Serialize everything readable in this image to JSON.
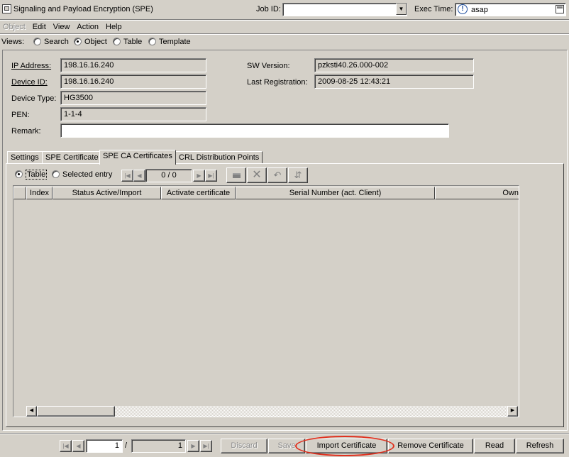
{
  "window": {
    "title": "Signaling and Payload Encryption (SPE)"
  },
  "job": {
    "label": "Job ID:",
    "value": ""
  },
  "exec": {
    "label": "Exec Time:",
    "value": "asap"
  },
  "menu": {
    "object": "Object",
    "edit": "Edit",
    "view": "View",
    "action": "Action",
    "help": "Help"
  },
  "views": {
    "label": "Views:",
    "options": [
      "Search",
      "Object",
      "Table",
      "Template"
    ],
    "selected": "Object"
  },
  "fields": {
    "ip_label": "IP Address:",
    "ip_value": "198.16.16.240",
    "device_id_label": "Device ID:",
    "device_id_value": "198.16.16.240",
    "device_type_label": "Device Type:",
    "device_type_value": "HG3500",
    "pen_label": "PEN:",
    "pen_value": "1-1-4",
    "remark_label": "Remark:",
    "remark_value": "",
    "sw_label": "SW Version:",
    "sw_value": "pzksti40.26.000-002",
    "lastreg_label": "Last Registration:",
    "lastreg_value": "2009-08-25 12:43:21"
  },
  "tabs": [
    "Settings",
    "SPE Certificate",
    "SPE CA Certificates",
    "CRL Distribution Points"
  ],
  "active_tab": "SPE CA Certificates",
  "subview": {
    "table": "Table",
    "selected_entry": "Selected entry",
    "selected": "Table",
    "counter": "0 / 0"
  },
  "table": {
    "columns": [
      "Index",
      "Status Active/Import",
      "Activate certificate",
      "Serial Number (act. Client)",
      "Own"
    ]
  },
  "bottom": {
    "page_current": "1",
    "page_sep": "/",
    "page_total": "1",
    "discard": "Discard",
    "save": "Save",
    "import": "Import Certificate",
    "remove": "Remove Certificate",
    "read": "Read",
    "refresh": "Refresh"
  },
  "colors": {
    "background": "#d4d0c8",
    "highlight_ellipse": "#e0301e"
  }
}
